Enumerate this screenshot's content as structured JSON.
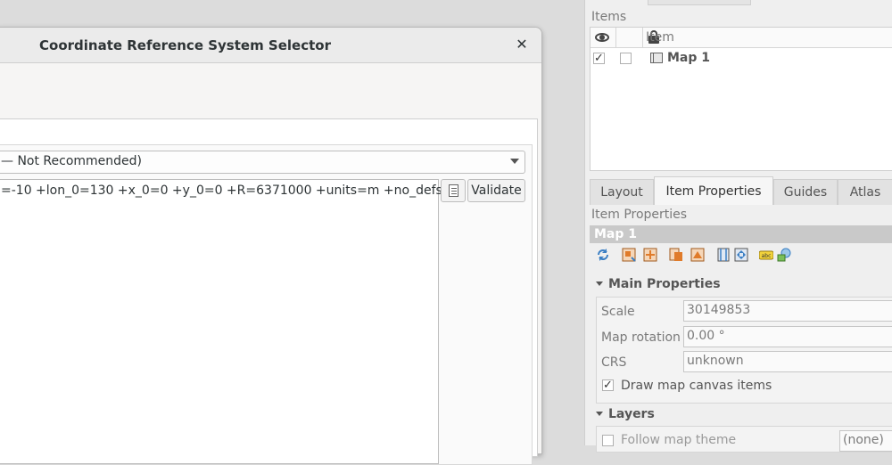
{
  "dialog": {
    "title": "Coordinate Reference System Selector",
    "close_glyph": "✕",
    "format_value": "— Not Recommended)",
    "parameters": "=-10 +lon_0=130 +x_0=0 +y_0=0 +R=6371000 +units=m +no_defs",
    "validate_label": "Validate"
  },
  "items_panel": {
    "label": "Items",
    "header_item": "Item",
    "rows": [
      {
        "label": "Map 1",
        "visible": true,
        "locked": false
      }
    ]
  },
  "tabs": [
    "Layout",
    "Item Properties",
    "Guides",
    "Atlas"
  ],
  "item_properties": {
    "label": "Item Properties",
    "selected_item": "Map 1",
    "main_properties": {
      "title": "Main Properties",
      "scale_label": "Scale",
      "scale_value": "30149853",
      "rotation_label": "Map rotation",
      "rotation_value": "0.00 °",
      "crs_label": "CRS",
      "crs_value": "unknown",
      "draw_canvas_label": "Draw map canvas items",
      "draw_canvas_checked": true
    },
    "layers": {
      "title": "Layers",
      "follow_theme_label": "Follow map theme",
      "theme_value": "(none)"
    }
  },
  "toolbar_icons": [
    "refresh-icon",
    "extent-from-canvas-icon",
    "set-canvas-extent-icon",
    "atlas-feature-icon",
    "set-canvas-to-atlas-icon",
    "view-extent-icon",
    "move-content-icon",
    "label-settings-icon",
    "overview-icon"
  ],
  "colors": {
    "accent_blue": "#3b7fc4",
    "icon_orange": "#e07b2a",
    "selected_bar": "#c9c9c9"
  }
}
